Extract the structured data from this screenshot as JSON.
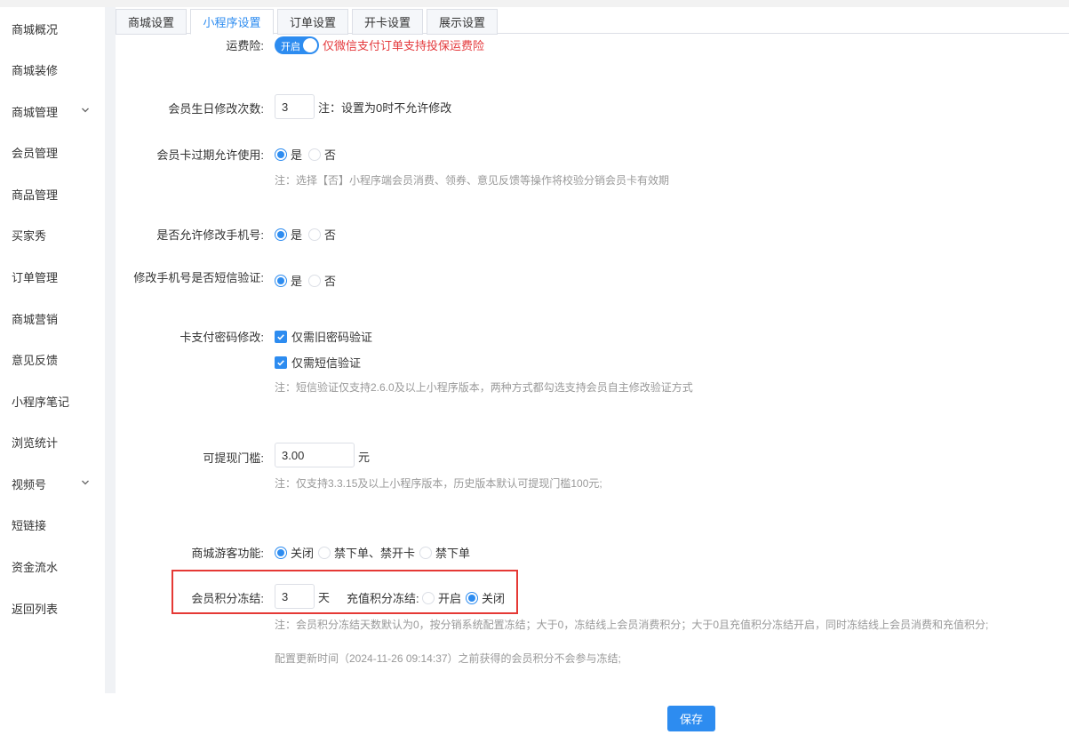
{
  "sidebar": {
    "items": [
      {
        "label": "商城概况"
      },
      {
        "label": "商城装修"
      },
      {
        "label": "商城管理"
      },
      {
        "label": "会员管理"
      },
      {
        "label": "商品管理"
      },
      {
        "label": "买家秀"
      },
      {
        "label": "订单管理"
      },
      {
        "label": "商城营销"
      },
      {
        "label": "意见反馈"
      },
      {
        "label": "小程序笔记"
      },
      {
        "label": "浏览统计"
      },
      {
        "label": "视频号"
      },
      {
        "label": "短链接"
      },
      {
        "label": "资金流水"
      },
      {
        "label": "返回列表"
      }
    ]
  },
  "tabs": [
    {
      "label": "商城设置"
    },
    {
      "label": "小程序设置",
      "active": true
    },
    {
      "label": "订单设置"
    },
    {
      "label": "开卡设置"
    },
    {
      "label": "展示设置"
    }
  ],
  "form": {
    "shipping_insurance": {
      "label": "运费险:",
      "switch_text": "开启",
      "hint": "仅微信支付订单支持投保运费险"
    },
    "birthday_edit": {
      "label": "会员生日修改次数:",
      "value": "3",
      "note": "注：设置为0时不允许修改"
    },
    "card_expired_use": {
      "label": "会员卡过期允许使用:",
      "yes": "是",
      "no": "否",
      "selected": "是",
      "note": "注：选择【否】小程序端会员消费、领券、意见反馈等操作将校验分销会员卡有效期"
    },
    "allow_phone_change": {
      "label": "是否允许修改手机号:",
      "yes": "是",
      "no": "否",
      "selected": "是"
    },
    "phone_sms_verify": {
      "label": "修改手机号是否短信验证:",
      "yes": "是",
      "no": "否",
      "selected": "是"
    },
    "card_pwd_change": {
      "label": "卡支付密码修改:",
      "option1": "仅需旧密码验证",
      "option2": "仅需短信验证",
      "note": "注：短信验证仅支持2.6.0及以上小程序版本，两种方式都勾选支持会员自主修改验证方式"
    },
    "withdraw_threshold": {
      "label": "可提现门槛:",
      "value": "3.00",
      "unit": "元",
      "note": "注：仅支持3.3.15及以上小程序版本，历史版本默认可提现门槛100元;"
    },
    "guest_mode": {
      "label": "商城游客功能:",
      "options": [
        "关闭",
        "禁下单、禁开卡",
        "禁下单"
      ],
      "selected": "关闭"
    },
    "points_freeze": {
      "label": "会员积分冻结:",
      "value": "3",
      "unit": "天",
      "recharge_label": "充值积分冻结:",
      "recharge_on": "开启",
      "recharge_off": "关闭",
      "recharge_selected": "关闭",
      "note1": "注：会员积分冻结天数默认为0，按分销系统配置冻结；大于0，冻结线上会员消费积分；大于0且充值积分冻结开启，同时冻结线上会员消费和充值积分;",
      "note2": "配置更新时间（2024-11-26 09:14:37）之前获得的会员积分不会参与冻结;"
    }
  },
  "save_label": "保存",
  "colors": {
    "primary": "#2d8cf0",
    "highlight": "#e53935",
    "hint_red": "#e4393c"
  }
}
